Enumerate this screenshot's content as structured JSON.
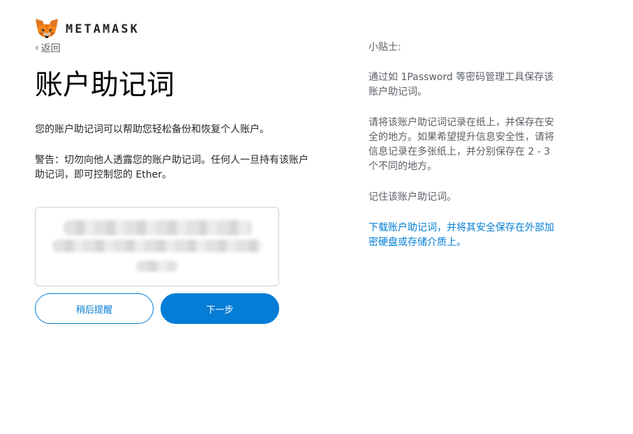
{
  "brand": {
    "wordmark": "METAMASK",
    "logo_icon": "metamask-fox-icon",
    "fox_orange": "#e2761b",
    "fox_light": "#f6851b"
  },
  "nav": {
    "back_label": "返回",
    "back_icon": "chevron-left-icon"
  },
  "page": {
    "title": "账户助记词",
    "description": "您的账户助记词可以帮助您轻松备份和恢复个人账户。",
    "warning": "警告：切勿向他人透露您的账户助记词。任何人一旦持有该账户助记词，即可控制您的 Ether。"
  },
  "buttons": {
    "remind_later": "稍后提醒",
    "next": "下一步"
  },
  "tips": {
    "heading": "小贴士:",
    "items": [
      "通过如 1Password 等密码管理工具保存该账户助记词。",
      "请将该账户助记词记录在纸上，并保存在安全的地方。如果希望提升信息安全性，请将信息记录在多张纸上，并分别保存在 2 - 3 个不同的地方。",
      "记住该账户助记词。"
    ],
    "download_link": "下载账户助记词，并将其安全保存在外部加密硬盘或存储介质上。"
  },
  "colors": {
    "accent": "#037dd6",
    "text_primary": "#24272a",
    "text_secondary": "#5a5f66",
    "border": "#cdd1d5"
  }
}
